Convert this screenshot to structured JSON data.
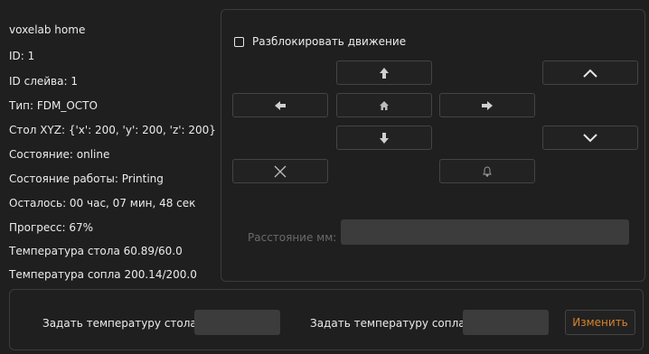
{
  "printer": {
    "name": "voxelab home",
    "id": "ID: 1",
    "slave_id": "ID слейва: 1",
    "type": "Тип: FDM_OCTO",
    "bed_xyz": "Стол XYZ: {'x': 200, 'y': 200, 'z': 200}",
    "status": "Состояние: online",
    "job_status": "Состояние работы: Printing",
    "remaining": "Осталось: 00 час, 07 мин, 48 сек",
    "progress": "Прогресс: 67%",
    "bed_temp": "Температура стола 60.89/60.0",
    "nozzle_temp": "Температура сопла 200.14/200.0"
  },
  "movement": {
    "unlock_label": "Разблокировать движение",
    "unlock_checked": false,
    "distance_label": "Расстояние мм:",
    "distance_value": ""
  },
  "temperature": {
    "bed_label": "Задать температуру стола",
    "bed_value": "",
    "nozzle_label": "Задать температуру сопла",
    "nozzle_value": "",
    "apply_label": "Изменить",
    "apply_color": "#d7822a"
  },
  "icons": {
    "y_up": "arrow-up-icon",
    "x_left": "arrow-left-icon",
    "home": "home-icon",
    "x_right": "arrow-right-icon",
    "y_down": "arrow-down-icon",
    "z_up": "chevron-up-icon",
    "z_down": "chevron-down-icon",
    "stop": "close-icon",
    "notify": "bell-icon"
  }
}
